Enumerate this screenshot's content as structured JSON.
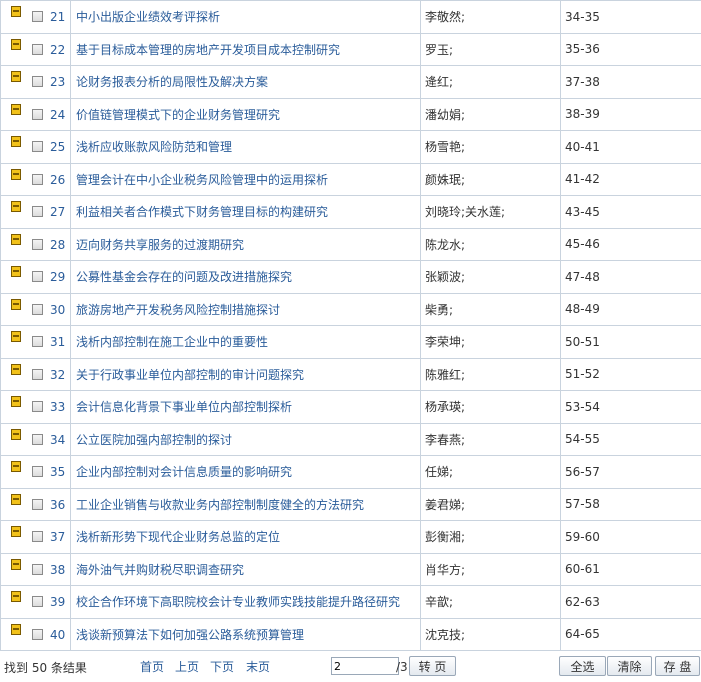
{
  "rows": [
    {
      "num": "21",
      "title": "中小出版企业绩效考评探析",
      "author": "李敬然;",
      "pages": "34-35"
    },
    {
      "num": "22",
      "title": "基于目标成本管理的房地产开发项目成本控制研究",
      "author": "罗玉;",
      "pages": "35-36"
    },
    {
      "num": "23",
      "title": "论财务报表分析的局限性及解决方案",
      "author": "逄红;",
      "pages": "37-38"
    },
    {
      "num": "24",
      "title": "价值链管理模式下的企业财务管理研究",
      "author": "潘幼娟;",
      "pages": "38-39"
    },
    {
      "num": "25",
      "title": "浅析应收账款风险防范和管理",
      "author": "杨雪艳;",
      "pages": "40-41"
    },
    {
      "num": "26",
      "title": "管理会计在中小企业税务风险管理中的运用探析",
      "author": "颜姝珉;",
      "pages": "41-42"
    },
    {
      "num": "27",
      "title": "利益相关者合作模式下财务管理目标的构建研究",
      "author": "刘晓玲;关水莲;",
      "pages": "43-45"
    },
    {
      "num": "28",
      "title": "迈向财务共享服务的过渡期研究",
      "author": "陈龙水;",
      "pages": "45-46"
    },
    {
      "num": "29",
      "title": "公募性基金会存在的问题及改进措施探究",
      "author": "张颖波;",
      "pages": "47-48"
    },
    {
      "num": "30",
      "title": "旅游房地产开发税务风险控制措施探讨",
      "author": "柴勇;",
      "pages": "48-49"
    },
    {
      "num": "31",
      "title": "浅析内部控制在施工企业中的重要性",
      "author": "李荣坤;",
      "pages": "50-51"
    },
    {
      "num": "32",
      "title": "关于行政事业单位内部控制的审计问题探究",
      "author": "陈雅红;",
      "pages": "51-52"
    },
    {
      "num": "33",
      "title": "会计信息化背景下事业单位内部控制探析",
      "author": "杨承瑛;",
      "pages": "53-54"
    },
    {
      "num": "34",
      "title": "公立医院加强内部控制的探讨",
      "author": "李春燕;",
      "pages": "54-55"
    },
    {
      "num": "35",
      "title": "企业内部控制对会计信息质量的影响研究",
      "author": "任娣;",
      "pages": "56-57"
    },
    {
      "num": "36",
      "title": "工业企业销售与收款业务内部控制制度健全的方法研究",
      "author": "姜君娣;",
      "pages": "57-58"
    },
    {
      "num": "37",
      "title": "浅析新形势下现代企业财务总监的定位",
      "author": "彭衡湘;",
      "pages": "59-60"
    },
    {
      "num": "38",
      "title": "海外油气并购财税尽职调查研究",
      "author": "肖华方;",
      "pages": "60-61"
    },
    {
      "num": "39",
      "title": "校企合作环境下高职院校会计专业教师实践技能提升路径研究",
      "author": "辛歆;",
      "pages": "62-63"
    },
    {
      "num": "40",
      "title": "浅谈新预算法下如何加强公路系统预算管理",
      "author": "沈克技;",
      "pages": "64-65"
    }
  ],
  "footer": {
    "count_text": "找到 50 条结果",
    "first": "首页",
    "prev": "上页",
    "next": "下页",
    "last": "末页",
    "page_value": "2",
    "total_pages": "/3",
    "go": "转 页",
    "select_all": "全选",
    "clear": "清除",
    "save": "存 盘"
  }
}
